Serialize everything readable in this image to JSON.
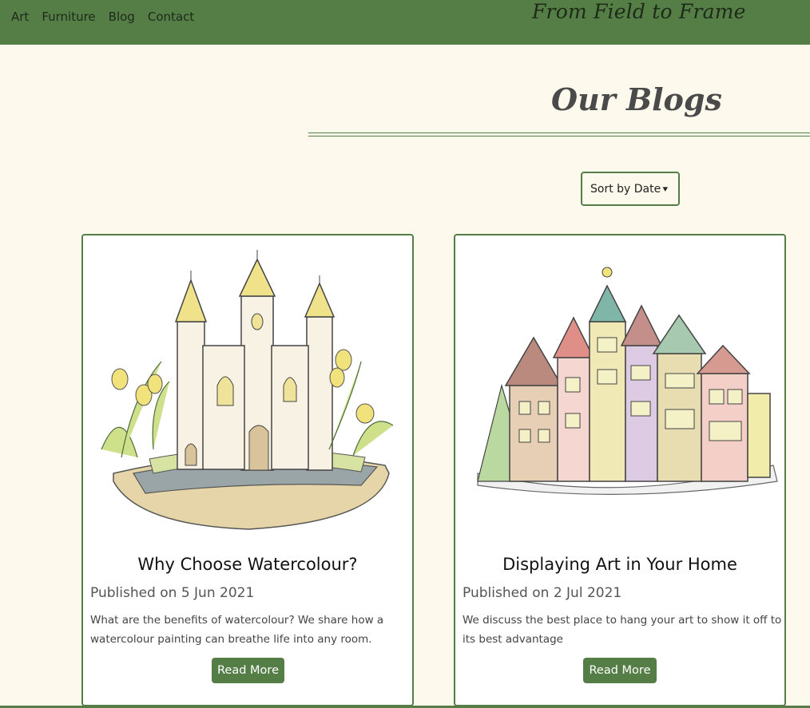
{
  "nav": {
    "items": [
      "Art",
      "Furniture",
      "Blog",
      "Contact"
    ]
  },
  "brand": "From Field to Frame",
  "page_title": "Our Blogs",
  "sort": {
    "label": "Sort by Date"
  },
  "posts": [
    {
      "title": "Why Choose Watercolour?",
      "published": "Published on 5 Jun 2021",
      "description": "What are the benefits of watercolour? We share how a watercolour painting can breathe life into any room.",
      "button": "Read More",
      "image_icon": "watercolour-castle-illustration"
    },
    {
      "title": "Displaying Art in Your Home",
      "published": "Published on 2 Jul 2021",
      "description": "We discuss the best place to hang your art to show it off to its best advantage",
      "button": "Read More",
      "image_icon": "watercolour-town-illustration"
    }
  ],
  "colors": {
    "accent": "#557e47",
    "background": "#fdf9ed"
  }
}
